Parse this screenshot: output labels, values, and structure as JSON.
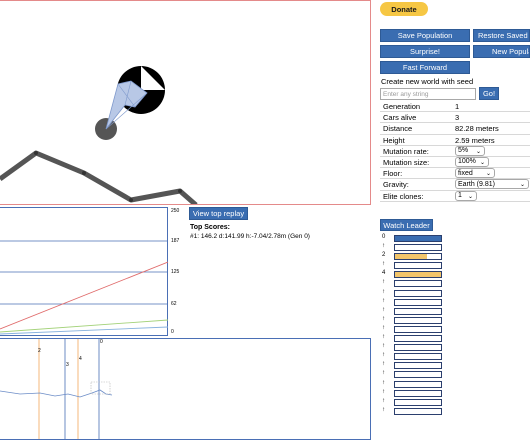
{
  "buttons": {
    "donate": "Donate",
    "save_population": "Save Population",
    "restore_saved": "Restore Saved Po",
    "surprise": "Surprise!",
    "new_population": "New Popula",
    "fast_forward": "Fast Forward",
    "go": "Go!",
    "view_top_replay": "View top replay",
    "watch_leader": "Watch Leader"
  },
  "seed": {
    "label": "Create new world with seed",
    "placeholder": "Enter any string",
    "value": ""
  },
  "stats": {
    "generation": {
      "label": "Generation",
      "value": "1"
    },
    "cars_alive": {
      "label": "Cars alive",
      "value": "3"
    },
    "distance": {
      "label": "Distance",
      "value": "82.28 meters"
    },
    "height": {
      "label": "Height",
      "value": "2.59 meters"
    },
    "mutation_rate": {
      "label": "Mutation rate:",
      "value": "5%"
    },
    "mutation_size": {
      "label": "Mutation size:",
      "value": "100%"
    },
    "floor": {
      "label": "Floor:",
      "value": "fixed"
    },
    "gravity": {
      "label": "Gravity:",
      "value": "Earth (9.81)"
    },
    "elite_clones": {
      "label": "Elite clones:",
      "value": "1"
    }
  },
  "scores": {
    "title": "Top Scores:",
    "entries": [
      "#1: 146.2 d:141.99 h:-7.04/2.78m (Gen 0)"
    ]
  },
  "graph": {
    "y_ticks": [
      "250",
      "187",
      "125",
      "62",
      "0"
    ],
    "series_colors": {
      "top": "#e06b6b",
      "average": "#a4d27a",
      "elite": "#88b2de"
    }
  },
  "minimap": {
    "markers": [
      "2",
      "3",
      "4",
      "0"
    ]
  },
  "leaderboard": [
    {
      "label": "0",
      "fill": 1.0,
      "color": "#3a6db1"
    },
    {
      "label": "↑",
      "fill": 0,
      "color": "#f2c56b"
    },
    {
      "label": "2",
      "fill": 0.7,
      "color": "#f2c56b"
    },
    {
      "label": "↑",
      "fill": 0,
      "color": "#f2c56b"
    },
    {
      "label": "4",
      "fill": 1.0,
      "color": "#f2c56b"
    },
    {
      "label": "↑",
      "fill": 0,
      "color": "#f2c56b"
    },
    {
      "label": "↑",
      "fill": 0,
      "color": "#f2c56b"
    },
    {
      "label": "↑",
      "fill": 0,
      "color": "#f2c56b"
    },
    {
      "label": "↑",
      "fill": 0,
      "color": "#f2c56b"
    },
    {
      "label": "↑",
      "fill": 0,
      "color": "#f2c56b"
    },
    {
      "label": "↑",
      "fill": 0,
      "color": "#f2c56b"
    },
    {
      "label": "↑",
      "fill": 0,
      "color": "#f2c56b"
    },
    {
      "label": "↑",
      "fill": 0,
      "color": "#f2c56b"
    },
    {
      "label": "↑",
      "fill": 0,
      "color": "#f2c56b"
    },
    {
      "label": "↑",
      "fill": 0,
      "color": "#f2c56b"
    },
    {
      "label": "↑",
      "fill": 0,
      "color": "#f2c56b"
    },
    {
      "label": "↑",
      "fill": 0,
      "color": "#f2c56b"
    },
    {
      "label": "↑",
      "fill": 0,
      "color": "#f2c56b"
    },
    {
      "label": "↑",
      "fill": 0,
      "color": "#f2c56b"
    },
    {
      "label": "↑",
      "fill": 0,
      "color": "#f2c56b"
    }
  ]
}
